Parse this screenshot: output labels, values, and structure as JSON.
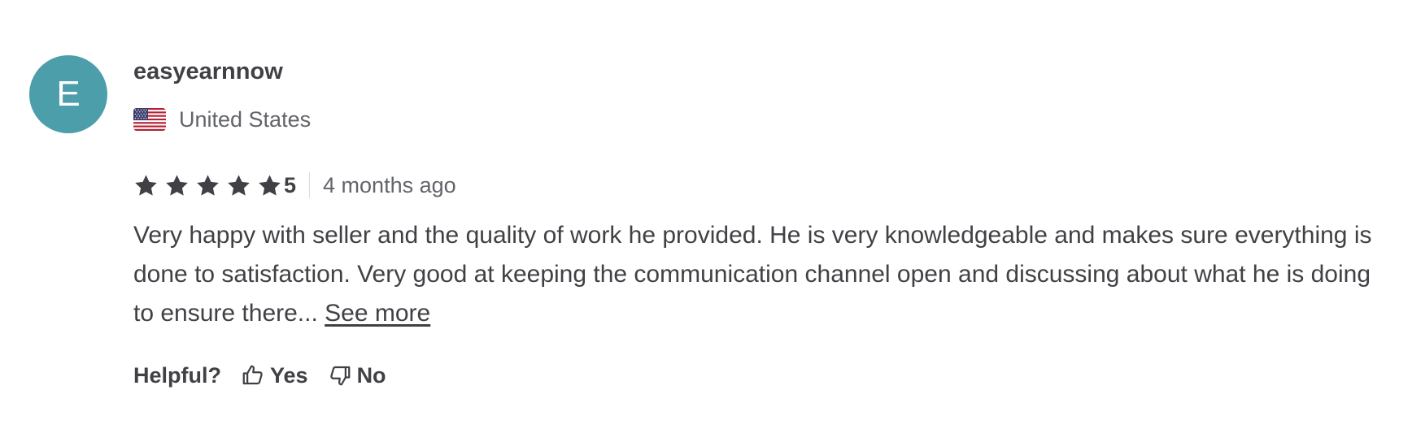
{
  "review": {
    "avatar_letter": "E",
    "avatar_color": "#4d9eab",
    "username": "easyearnnow",
    "country": "United States",
    "flag_icon": "us-flag-icon",
    "rating": {
      "stars": 5,
      "max_stars": 5,
      "score_label": "5",
      "star_icon": "star-icon",
      "star_color": "#404145"
    },
    "time_ago": "4 months ago",
    "text": "Very happy with seller and the quality of work he provided. He is very knowledgeable and makes sure everything is done to satisfaction. Very good at keeping the communication channel open and discussing about what he is doing to ensure there...",
    "see_more_label": "See more",
    "helpful": {
      "label": "Helpful?",
      "yes_label": "Yes",
      "no_label": "No",
      "yes_icon": "thumbs-up-icon",
      "no_icon": "thumbs-down-icon"
    }
  }
}
